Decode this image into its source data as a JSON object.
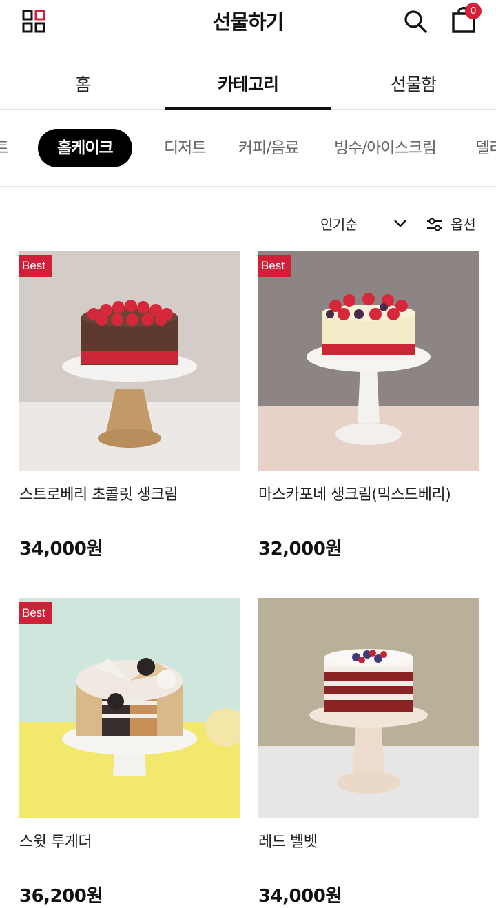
{
  "header": {
    "title": "선물하기",
    "cart_count": "0",
    "icons": {
      "menu": "grid-menu-icon",
      "search": "search-icon",
      "cart": "shopping-bag-icon"
    }
  },
  "main_tabs": [
    {
      "label": "홈"
    },
    {
      "label": "카테고리",
      "active": true
    },
    {
      "label": "선물함"
    }
  ],
  "sub_tabs": [
    {
      "label": "트"
    },
    {
      "label": "홀케이크",
      "active": true
    },
    {
      "label": "디저트"
    },
    {
      "label": "커피/음료"
    },
    {
      "label": "빙수/아이스크림"
    },
    {
      "label": "델리"
    }
  ],
  "sort": {
    "label": "인기순",
    "option_label": "옵션"
  },
  "products": [
    {
      "name": "스트로베리 초콜릿 생크림",
      "price": "34,000원",
      "badge": "Best"
    },
    {
      "name": "마스카포네 생크림(믹스드베리)",
      "price": "32,000원",
      "badge": "Best"
    },
    {
      "name": "스윗 투게더",
      "price": "36,200원",
      "badge": "Best"
    },
    {
      "name": "레드 벨벳",
      "price": "34,000원",
      "badge": ""
    }
  ],
  "colors": {
    "accent": "#cf2038",
    "active_chip": "#000000"
  }
}
